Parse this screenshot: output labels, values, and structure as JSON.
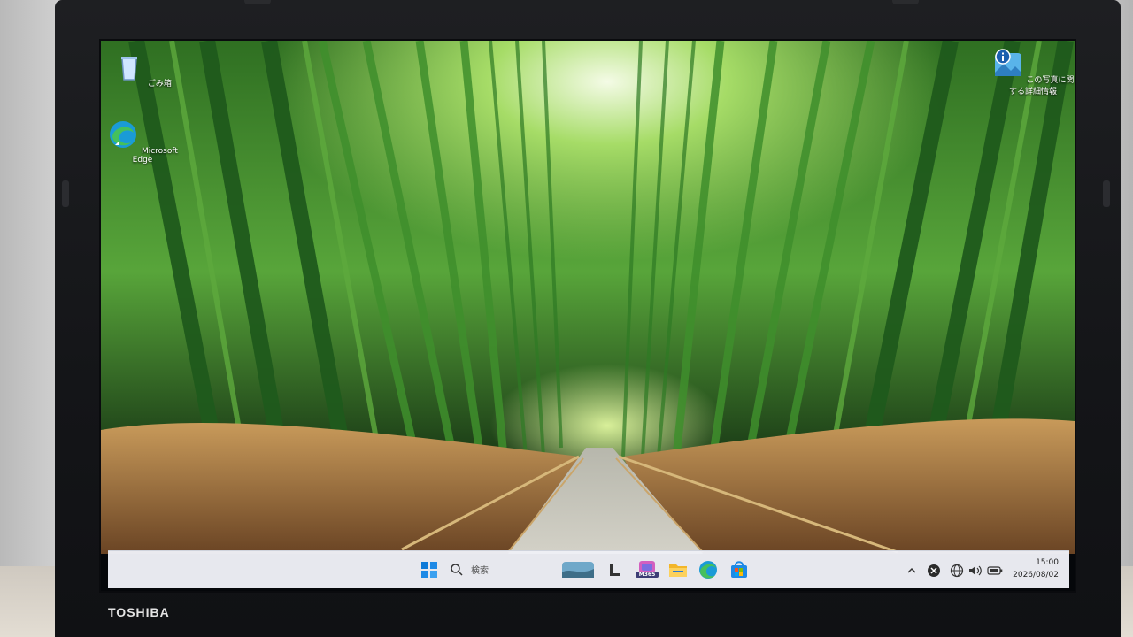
{
  "device": {
    "brand": "TOSHIBA"
  },
  "desktop": {
    "icons": [
      {
        "label": "ごみ箱",
        "icon": "recycle-bin-icon"
      },
      {
        "label": "Microsoft Edge",
        "icon": "edge-icon"
      },
      {
        "label": "この写真に関する詳細情報",
        "icon": "learn-about-picture-icon"
      }
    ]
  },
  "taskbar": {
    "search_placeholder": "検索",
    "pinned": [
      "start-icon",
      "search-icon",
      "widgets-icon",
      "task-view-icon",
      "m365-icon",
      "file-explorer-icon",
      "edge-icon",
      "store-icon"
    ],
    "m365_badge": "M365",
    "tray": [
      "chevron-up-icon",
      "close-circle-icon",
      "globe-icon",
      "speaker-icon",
      "battery-icon"
    ],
    "time": "15:00",
    "date": "2026/08/02"
  },
  "colors": {
    "taskbar_bg": "#eef0f6",
    "accent": "#0f7bd8",
    "bamboo": "#3c9a2e"
  }
}
